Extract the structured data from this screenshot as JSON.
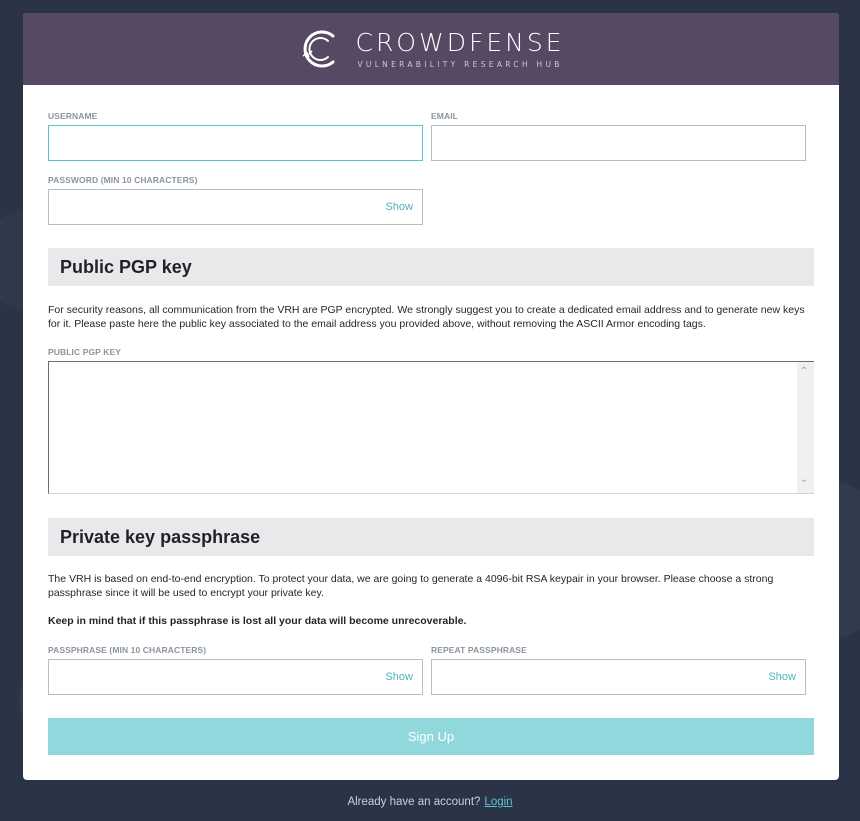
{
  "brand": {
    "name": "CROWDFENSE",
    "tagline": "VULNERABILITY RESEARCH HUB"
  },
  "form": {
    "username_label": "USERNAME",
    "email_label": "EMAIL",
    "password_label": "PASSWORD (MIN 10 CHARACTERS)",
    "show_label": "Show"
  },
  "pgp": {
    "heading": "Public PGP key",
    "description": "For security reasons, all communication from the VRH are PGP encrypted. We strongly suggest you to create a dedicated email address and to generate new keys for it. Please paste here the public key associated to the email address you provided above, without removing the ASCII Armor encoding tags.",
    "field_label": "PUBLIC PGP KEY"
  },
  "passphrase": {
    "heading": "Private key passphrase",
    "description": "The VRH is based on end-to-end encryption. To protect your data, we are going to generate a 4096-bit RSA keypair in your browser. Please choose a strong passphrase since it will be used to encrypt your private key.",
    "warning": "Keep in mind that if this passphrase is lost all your data will become unrecoverable.",
    "passphrase_label": "PASSPHRASE (MIN 10 CHARACTERS)",
    "repeat_label": "REPEAT PASSPHRASE"
  },
  "submit_label": "Sign Up",
  "footer": {
    "text": "Already have an account?",
    "login_label": "Login"
  },
  "colors": {
    "header_bg": "#574863",
    "page_bg": "#2b3447",
    "accent": "#5bc0d0",
    "button_bg": "#90d8db"
  }
}
